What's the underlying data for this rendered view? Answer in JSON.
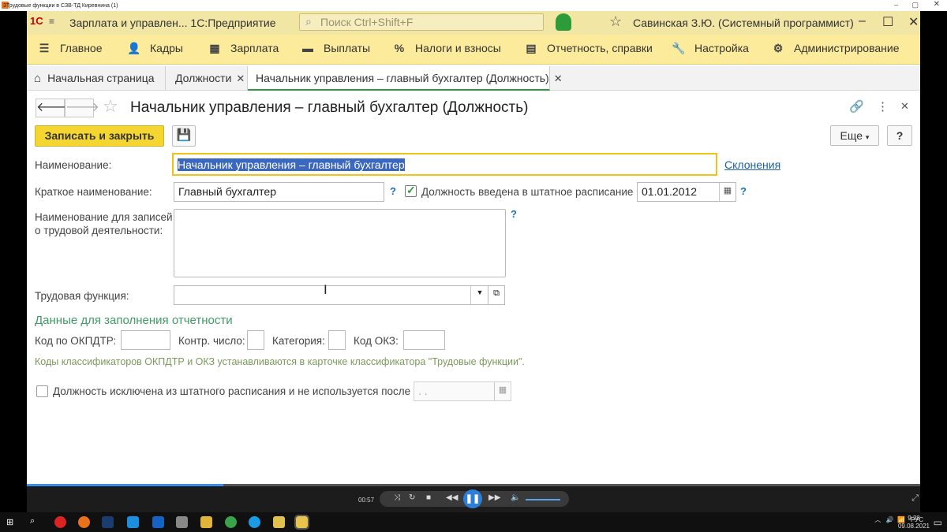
{
  "player": {
    "window_title": "3Трудовые функции в  СЗВ-ТД Киревнина (1)",
    "time": "00:57",
    "progress_fraction": 0.22
  },
  "app": {
    "logo": "1C",
    "title": "Зарплата и управлен...  1С:Предприятие",
    "search_placeholder": "Поиск Ctrl+Shift+F",
    "user": "Савинская З.Ю. (Системный программист)"
  },
  "menu": [
    {
      "icon": "menu-icon",
      "label": "Главное"
    },
    {
      "icon": "people-icon",
      "label": "Кадры"
    },
    {
      "icon": "calculator-icon",
      "label": "Зарплата"
    },
    {
      "icon": "wallet-icon",
      "label": "Выплаты"
    },
    {
      "icon": "percent-icon",
      "label": "Налоги и взносы"
    },
    {
      "icon": "report-icon",
      "label": "Отчетность, справки"
    },
    {
      "icon": "wrench-icon",
      "label": "Настройка"
    },
    {
      "icon": "gear-icon",
      "label": "Администрирование"
    }
  ],
  "tabs": [
    {
      "label": "Начальная страница"
    },
    {
      "label": "Должности"
    },
    {
      "label": "Начальник управления – главный бухгалтер (Должность)"
    }
  ],
  "form": {
    "title": "Начальник управления – главный бухгалтер (Должность)",
    "save_close_label": "Записать и закрыть",
    "more_label": "Еще",
    "help_label": "?",
    "name_label": "Наименование:",
    "name_value": "Начальник управления – главный бухгалтер",
    "declensions_link": "Склонения",
    "short_name_label": "Краткое наименование:",
    "short_name_value": "Главный бухгалтер",
    "staffing_checkbox_label": "Должность введена в штатное расписание",
    "staffing_checked": true,
    "staffing_date": "01.01.2012",
    "work_record_label_line1": "Наименование для записей",
    "work_record_label_line2": "о трудовой деятельности:",
    "work_record_value": "",
    "labor_function_label": "Трудовая функция:",
    "labor_function_value": "",
    "reporting_header": "Данные для заполнения отчетности",
    "okpdtr_label": "Код по ОКПДТР:",
    "okpdtr_value": "",
    "control_number_label": "Контр. число:",
    "control_number_value": "",
    "category_label": "Категория:",
    "category_value": "",
    "okz_label": "Код ОКЗ:",
    "okz_value": "",
    "note": "Коды классификаторов ОКПДТР и ОКЗ устанавливаются в карточке классификатора \"Трудовые функции\".",
    "excluded_checkbox_label": "Должность исключена из штатного расписания и не используется после",
    "excluded_checked": false,
    "excluded_date": " .  .",
    "question_mark": "?"
  },
  "taskbar": {
    "language": "РУС",
    "time": "9:28",
    "date": "09.08.2021"
  },
  "colors": {
    "accent_yellow": "#f5d631",
    "menu_yellow": "#fbeb9a",
    "green_header": "#3d9d64",
    "link_blue": "#1c5fa6"
  }
}
